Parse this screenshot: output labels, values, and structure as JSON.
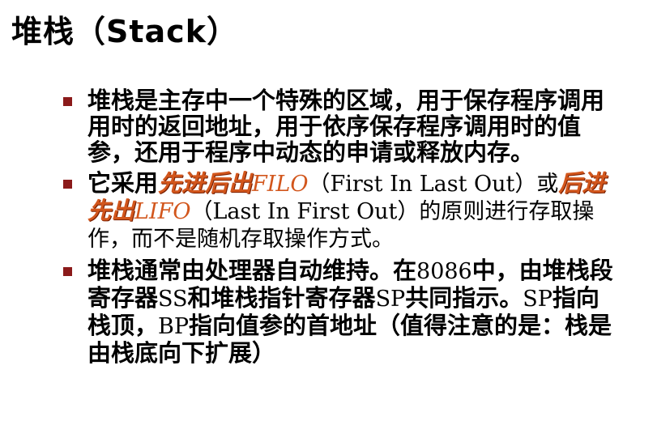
{
  "title": "堆栈（Stack）",
  "bullets": [
    {
      "text": "堆栈是主存中一个特殊的区域，用于保存程序调用用时的返回地址，用于依序保存程序调用时的值参，还用于程序中动态的申请或释放内存。"
    },
    {
      "part1": "它采用",
      "accent1": "先进后出",
      "code1": "FILO",
      "part2": "（First In Last Out）或",
      "accent2": "后进先出",
      "code2": "LIFO",
      "part3": "（Last In First Out）的原则进行存取操作，而不是随机存取操作方式。"
    },
    {
      "part1": "堆栈通常由处理器自动维持。在",
      "num1": "8086",
      "part2": "中，由堆栈段寄存器",
      "reg1": "SS",
      "part3": "和堆栈指针寄存器",
      "reg2": "SP",
      "part4": "共同指示。",
      "reg3": "SP",
      "part5": "指向栈顶，",
      "reg4": "BP",
      "part6": "指向值参的首地址（值得注意的是：栈是由栈底向下扩展）"
    }
  ],
  "colors": {
    "marker": "#8b1a1a",
    "accent": "#d2561c",
    "text": "#000000"
  }
}
